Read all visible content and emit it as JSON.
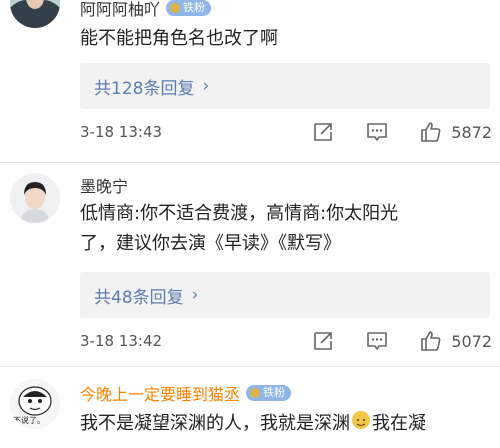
{
  "comments": [
    {
      "username": "阿阿阿柚吖",
      "badge": "铁粉",
      "text_lines": [
        "能不能把角色名也改了啊"
      ],
      "reply_label": "共128条回复",
      "time": "3-18 13:43",
      "likes": "5872"
    },
    {
      "username": "墨晚宁",
      "badge": "",
      "text_lines": [
        "低情商:你不适合费渡，高情商:你太阳光",
        "了，建议你去演《早读》《默写》"
      ],
      "reply_label": "共48条回复",
      "time": "3-18 13:42",
      "likes": "5072"
    },
    {
      "username": "今晚上一定要睡到猫丞",
      "badge": "铁粉",
      "text_part1": "我不是凝望深渊的人，我就是深渊",
      "text_part2": "我在凝",
      "avatar_caption": "不说了。"
    }
  ],
  "icons": {
    "reply_arrow": "chevron-right-icon",
    "share": "share-icon",
    "comment": "comment-icon",
    "like": "thumbs-up-icon"
  },
  "colors": {
    "link": "#5d7cb0",
    "orange_name": "#ff8200",
    "badge_bg": "#8fb6e6"
  }
}
